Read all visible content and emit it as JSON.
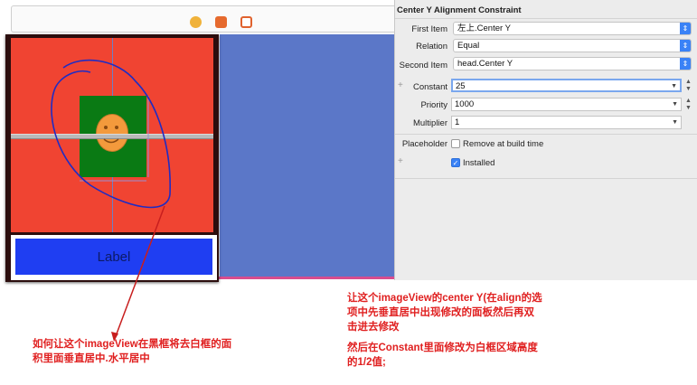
{
  "canvas": {
    "label_text": "Label",
    "icons": [
      "first-responder-icon",
      "exit-icon",
      "view-controller-icon"
    ]
  },
  "inspector": {
    "title": "Center Y Alignment Constraint",
    "first_item": {
      "label": "First Item",
      "value": "左上.Center Y"
    },
    "relation": {
      "label": "Relation",
      "value": "Equal"
    },
    "second_item": {
      "label": "Second Item",
      "value": "head.Center Y"
    },
    "constant": {
      "label": "Constant",
      "value": "25"
    },
    "priority": {
      "label": "Priority",
      "value": "1000"
    },
    "multiplier": {
      "label": "Multiplier",
      "value": "1"
    },
    "placeholder": {
      "label": "Placeholder",
      "checkbox_label": "Remove at build time",
      "checked": false
    },
    "installed": {
      "label": "Installed",
      "checked": true
    }
  },
  "annotations": {
    "note_top_line1": "让这个imageView的center Y(在align的选",
    "note_top_line2": "项中先垂直居中出现修改的面板然后再双",
    "note_top_line3": "击进去修改",
    "note_bottom_line1": "然后在Constant里面修改为白框区域高度",
    "note_bottom_line2": "的1/2值;",
    "note_left_line1": "如何让这个imageView在黑框将去白框的面",
    "note_left_line2": "积里面垂直居中.水平居中"
  },
  "colors": {
    "red_view": "#f04432",
    "blue_view": "#5b77c8",
    "label_bg": "#1f3ef2",
    "accent": "#3a82f6",
    "annotation": "#e02020"
  }
}
